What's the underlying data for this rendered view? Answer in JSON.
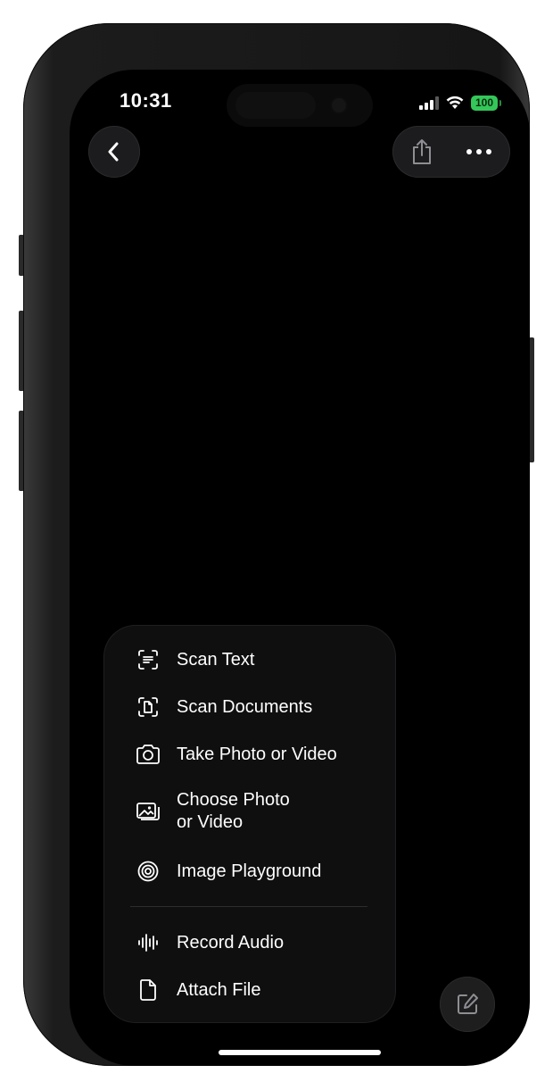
{
  "status_bar": {
    "time": "10:31",
    "battery_level": "100",
    "battery_color": "#34c759"
  },
  "toolbar": {
    "back_icon": "chevron-left-icon",
    "share_icon": "share-icon",
    "more_icon": "ellipsis-icon"
  },
  "attach_menu": {
    "items": [
      {
        "label": "Scan Text",
        "icon": "scan-text-icon"
      },
      {
        "label": "Scan Documents",
        "icon": "scan-document-icon"
      },
      {
        "label": "Take Photo or Video",
        "icon": "camera-icon"
      },
      {
        "label": "Choose Photo\nor Video",
        "icon": "photo-library-icon"
      },
      {
        "label": "Image Playground",
        "icon": "image-playground-icon"
      },
      {
        "label": "Record Audio",
        "icon": "waveform-icon"
      },
      {
        "label": "Attach File",
        "icon": "document-icon"
      }
    ]
  },
  "compose": {
    "icon": "compose-icon"
  }
}
